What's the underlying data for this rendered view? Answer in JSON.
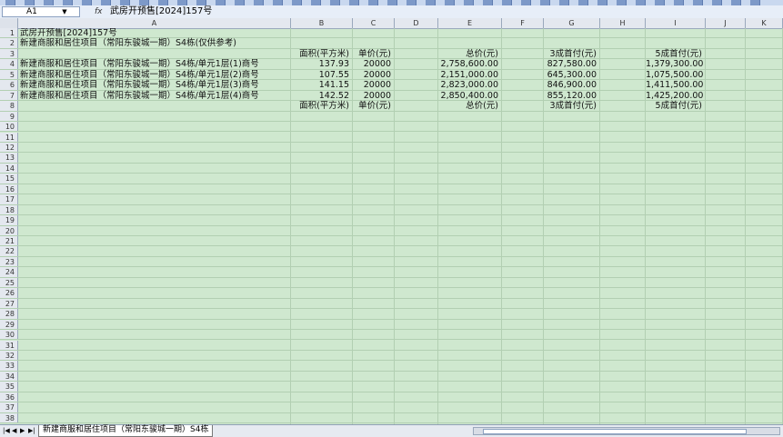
{
  "formula_bar": {
    "name_box": "A1",
    "fx_label": "fx",
    "content": "武房开预售[2024]157号"
  },
  "columns": [
    "A",
    "B",
    "C",
    "D",
    "E",
    "F",
    "G",
    "H",
    "I",
    "J",
    "K"
  ],
  "rows": [
    {
      "num": "1",
      "A": "武房开预售[2024]157号"
    },
    {
      "num": "2",
      "A": "新建商服和居住项目（常阳东骏城一期）S4栋(仅供参考)"
    },
    {
      "num": "3",
      "B": "面积(平方米)",
      "C": "单价(元)",
      "E": "总价(元)",
      "G": "3成首付(元)",
      "I": "5成首付(元)"
    },
    {
      "num": "4",
      "A": "新建商服和居住项目（常阳东骏城一期）S4栋/单元1层(1)商号",
      "B": "137.93",
      "C": "20000",
      "E": "2,758,600.00",
      "G": "827,580.00",
      "I": "1,379,300.00"
    },
    {
      "num": "5",
      "A": "新建商服和居住项目（常阳东骏城一期）S4栋/单元1层(2)商号",
      "B": "107.55",
      "C": "20000",
      "E": "2,151,000.00",
      "G": "645,300.00",
      "I": "1,075,500.00"
    },
    {
      "num": "6",
      "A": "新建商服和居住项目（常阳东骏城一期）S4栋/单元1层(3)商号",
      "B": "141.15",
      "C": "20000",
      "E": "2,823,000.00",
      "G": "846,900.00",
      "I": "1,411,500.00"
    },
    {
      "num": "7",
      "A": "新建商服和居住项目（常阳东骏城一期）S4栋/单元1层(4)商号",
      "B": "142.52",
      "C": "20000",
      "E": "2,850,400.00",
      "G": "855,120.00",
      "I": "1,425,200.00"
    },
    {
      "num": "8",
      "B": "面积(平方米)",
      "C": "单价(元)",
      "E": "总价(元)",
      "G": "3成首付(元)",
      "I": "5成首付(元)"
    },
    {
      "num": "9"
    },
    {
      "num": "10"
    },
    {
      "num": "11"
    },
    {
      "num": "12"
    },
    {
      "num": "13"
    },
    {
      "num": "14"
    },
    {
      "num": "15"
    },
    {
      "num": "16"
    },
    {
      "num": "17"
    },
    {
      "num": "18"
    },
    {
      "num": "19"
    },
    {
      "num": "20"
    },
    {
      "num": "21"
    },
    {
      "num": "22"
    },
    {
      "num": "23"
    },
    {
      "num": "24"
    },
    {
      "num": "25"
    },
    {
      "num": "26"
    },
    {
      "num": "27"
    },
    {
      "num": "28"
    },
    {
      "num": "29"
    },
    {
      "num": "30"
    },
    {
      "num": "31"
    },
    {
      "num": "32"
    },
    {
      "num": "33"
    },
    {
      "num": "34"
    },
    {
      "num": "35"
    },
    {
      "num": "36"
    },
    {
      "num": "37"
    },
    {
      "num": "38"
    }
  ],
  "sheet_tab": "新建商服和居住项目（常阳东骏城一期）S4栋",
  "nav_icons": [
    "first-sheet-icon",
    "prev-sheet-icon",
    "next-sheet-icon",
    "last-sheet-icon"
  ],
  "colors": {
    "sheet_bg": "#cfe8cf",
    "gridline": "#b2cfb2",
    "header_bg": "#e4e8ef"
  }
}
